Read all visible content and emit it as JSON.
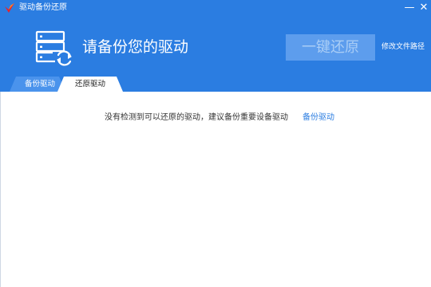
{
  "window": {
    "title": "驱动备份还原",
    "minimize": "—",
    "close": "✕"
  },
  "header": {
    "icon": "server-restore-icon",
    "headline": "请备份您的驱动",
    "restore_button": "一键还原",
    "change_path": "修改文件路径"
  },
  "tabs": [
    {
      "label": "备份驱动",
      "active": false
    },
    {
      "label": "还原驱动",
      "active": true
    }
  ],
  "content": {
    "empty_message": "没有检测到可以还原的驱动，建议备份重要设备驱动",
    "backup_link": "备份驱动"
  },
  "colors": {
    "header_bg": "#2b7de1",
    "button_bg": "#5d9ded",
    "link": "#2b7de1"
  }
}
